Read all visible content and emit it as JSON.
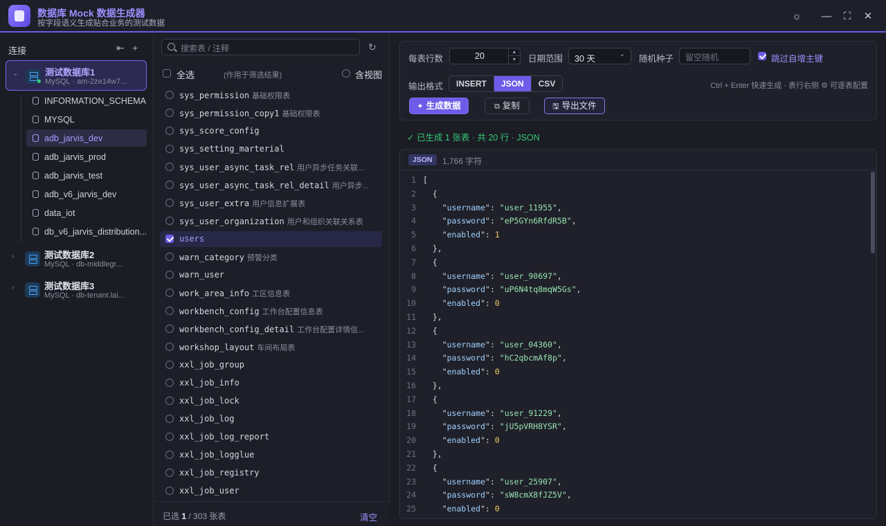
{
  "app": {
    "title": "数据库 Mock 数据生成器",
    "subtitle": "按字段语义生成贴合业务的测试数据",
    "window_controls": [
      "sun-icon",
      "minimize-icon",
      "maximize-icon",
      "close-icon"
    ]
  },
  "sidebar": {
    "header": "连接",
    "connections": [
      {
        "name": "测试数据库1",
        "detail": "MySQL · am-2ze14w7...",
        "expanded": true
      },
      {
        "name": "测试数据库2",
        "detail": "MySQL · db-middlegr...",
        "expanded": false
      },
      {
        "name": "测试数据库3",
        "detail": "MySQL · db-tenant.lai...",
        "expanded": false
      }
    ],
    "schemas": [
      "INFORMATION_SCHEMA",
      "MYSQL",
      "adb_jarvis_dev",
      "adb_jarvis_prod",
      "adb_jarvis_test",
      "adb_v6_jarvis_dev",
      "data_iot",
      "db_v6_jarvis_distribution..."
    ],
    "selected_schema": "adb_jarvis_dev"
  },
  "tables": {
    "search_placeholder": "搜索表 / 注释",
    "select_all": "全选",
    "select_all_hint": "(作用于筛选结果)",
    "include_views": "含视图",
    "items": [
      {
        "name": "sys_permission",
        "comment": "基础权限表",
        "checked": false
      },
      {
        "name": "sys_permission_copy1",
        "comment": "基础权限表",
        "checked": false
      },
      {
        "name": "sys_score_config",
        "comment": "",
        "checked": false
      },
      {
        "name": "sys_setting_marterial",
        "comment": "",
        "checked": false
      },
      {
        "name": "sys_user_async_task_rel",
        "comment": "用户异步任务关联...",
        "checked": false
      },
      {
        "name": "sys_user_async_task_rel_detail",
        "comment": "用户异步...",
        "checked": false
      },
      {
        "name": "sys_user_extra",
        "comment": "用户信息扩展表",
        "checked": false
      },
      {
        "name": "sys_user_organization",
        "comment": "用户和组织关联关系表",
        "checked": false
      },
      {
        "name": "users",
        "comment": "",
        "checked": true
      },
      {
        "name": "warn_category",
        "comment": "预警分类",
        "checked": false
      },
      {
        "name": "warn_user",
        "comment": "",
        "checked": false
      },
      {
        "name": "work_area_info",
        "comment": "工区信息表",
        "checked": false
      },
      {
        "name": "workbench_config",
        "comment": "工作台配置信息表",
        "checked": false
      },
      {
        "name": "workbench_config_detail",
        "comment": "工作台配置详情信...",
        "checked": false
      },
      {
        "name": "workshop_layout",
        "comment": "车间布局表",
        "checked": false
      },
      {
        "name": "xxl_job_group",
        "comment": "",
        "checked": false
      },
      {
        "name": "xxl_job_info",
        "comment": "",
        "checked": false
      },
      {
        "name": "xxl_job_lock",
        "comment": "",
        "checked": false
      },
      {
        "name": "xxl_job_log",
        "comment": "",
        "checked": false
      },
      {
        "name": "xxl_job_log_report",
        "comment": "",
        "checked": false
      },
      {
        "name": "xxl_job_logglue",
        "comment": "",
        "checked": false
      },
      {
        "name": "xxl_job_registry",
        "comment": "",
        "checked": false
      },
      {
        "name": "xxl_job_user",
        "comment": "",
        "checked": false
      }
    ],
    "footer_prefix": "已选",
    "selected_count": "1",
    "footer_suffix": "/ 303 张表",
    "clear_label": "清空"
  },
  "config": {
    "rows_label": "每表行数",
    "rows_value": "20",
    "date_range_label": "日期范围",
    "date_range_value": "30 天",
    "seed_label": "随机种子",
    "seed_placeholder": "留空随机",
    "skip_pk_label": "跳过自增主键",
    "skip_pk_checked": true,
    "format_label": "输出格式",
    "formats": [
      "INSERT",
      "JSON",
      "CSV"
    ],
    "active_format": "JSON",
    "hint": "Ctrl + Enter 快速生成 · 表行右侧 ⚙ 可逐表配置",
    "generate_label": "生成数据",
    "copy_label": "复制",
    "export_label": "导出文件"
  },
  "status": "已生成 1 张表 · 共 20 行 · JSON",
  "output": {
    "format_badge": "JSON",
    "char_count": "1,766 字符",
    "lines": [
      {
        "n": "1",
        "t": "["
      },
      {
        "n": "2",
        "t": "  {"
      },
      {
        "n": "3",
        "key": "username",
        "value": "user_11955",
        "vt": "s"
      },
      {
        "n": "4",
        "key": "password",
        "value": "eP5GYn6RfdR5B",
        "vt": "s"
      },
      {
        "n": "5",
        "key": "enabled",
        "value": "1",
        "vt": "n"
      },
      {
        "n": "6",
        "t": "  },"
      },
      {
        "n": "7",
        "t": "  {"
      },
      {
        "n": "8",
        "key": "username",
        "value": "user_90697",
        "vt": "s"
      },
      {
        "n": "9",
        "key": "password",
        "value": "uP6N4tq8mqW5Gs",
        "vt": "s"
      },
      {
        "n": "10",
        "key": "enabled",
        "value": "0",
        "vt": "n"
      },
      {
        "n": "11",
        "t": "  },"
      },
      {
        "n": "12",
        "t": "  {"
      },
      {
        "n": "13",
        "key": "username",
        "value": "user_04360",
        "vt": "s"
      },
      {
        "n": "14",
        "key": "password",
        "value": "hC2qbcmAf8p",
        "vt": "s"
      },
      {
        "n": "15",
        "key": "enabled",
        "value": "0",
        "vt": "n"
      },
      {
        "n": "16",
        "t": "  },"
      },
      {
        "n": "17",
        "t": "  {"
      },
      {
        "n": "18",
        "key": "username",
        "value": "user_91229",
        "vt": "s"
      },
      {
        "n": "19",
        "key": "password",
        "value": "jU5pVRH8YSR",
        "vt": "s"
      },
      {
        "n": "20",
        "key": "enabled",
        "value": "0",
        "vt": "n"
      },
      {
        "n": "21",
        "t": "  },"
      },
      {
        "n": "22",
        "t": "  {"
      },
      {
        "n": "23",
        "key": "username",
        "value": "user_25907",
        "vt": "s"
      },
      {
        "n": "24",
        "key": "password",
        "value": "sW8cmX8fJZ5V",
        "vt": "s"
      },
      {
        "n": "25",
        "key": "enabled",
        "value": "0",
        "vt": "n"
      }
    ]
  },
  "colors": {
    "accent": "#6d5ce8",
    "success": "#36c978",
    "background": "#1b1c24"
  }
}
